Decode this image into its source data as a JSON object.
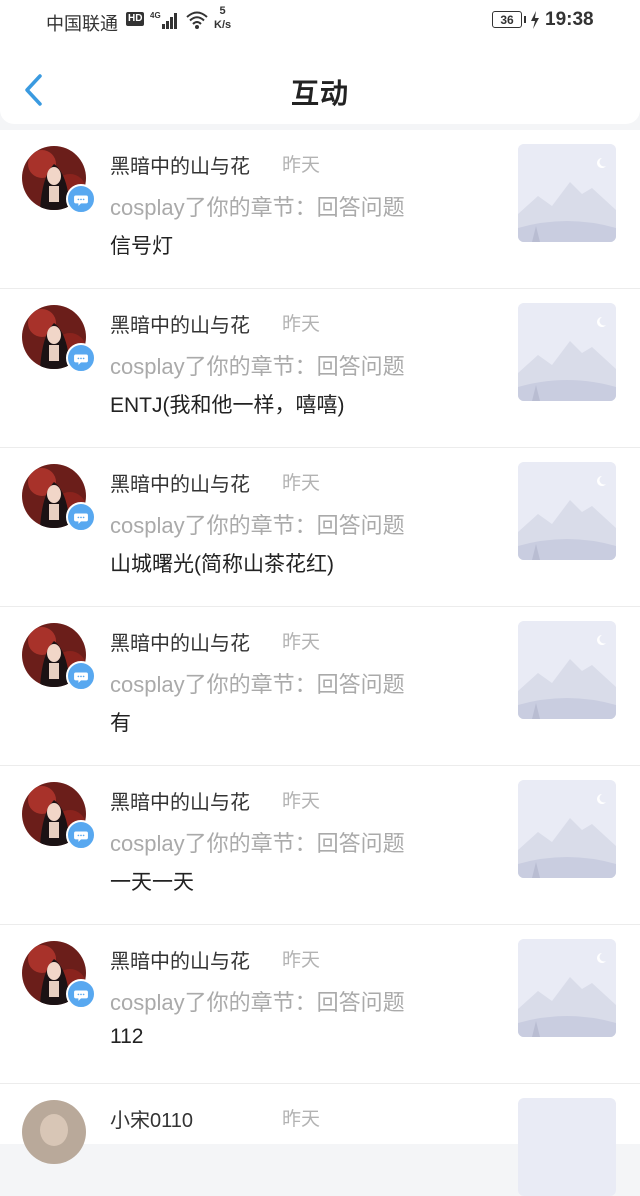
{
  "status_bar": {
    "carrier": "中国联通",
    "hd": "HD",
    "speed_value": "5",
    "speed_unit": "K/s",
    "battery": "36",
    "time": "19:38"
  },
  "header": {
    "title": "互动"
  },
  "items": [
    {
      "name": "黑暗中的山与花",
      "time": "昨天",
      "action": "cosplay了你的章节：回答问题",
      "content": "信号灯"
    },
    {
      "name": "黑暗中的山与花",
      "time": "昨天",
      "action": "cosplay了你的章节：回答问题",
      "content": "ENTJ(我和他一样，嘻嘻)"
    },
    {
      "name": "黑暗中的山与花",
      "time": "昨天",
      "action": "cosplay了你的章节：回答问题",
      "content": "山城曙光(简称山茶花红)"
    },
    {
      "name": "黑暗中的山与花",
      "time": "昨天",
      "action": "cosplay了你的章节：回答问题",
      "content": "有"
    },
    {
      "name": "黑暗中的山与花",
      "time": "昨天",
      "action": "cosplay了你的章节：回答问题",
      "content": "一天一天"
    },
    {
      "name": "黑暗中的山与花",
      "time": "昨天",
      "action": "cosplay了你的章节：回答问题",
      "content": "112"
    }
  ],
  "partial_item": {
    "name": "小宋0110",
    "time": "昨天"
  },
  "icons": {
    "back": "chevron-left-icon",
    "badge": "chat-bubble-icon",
    "thumbnail": "mountain-placeholder-icon"
  },
  "colors": {
    "accent": "#3a9ae0",
    "badge": "#58a8f0",
    "muted": "#aaaaaa"
  }
}
